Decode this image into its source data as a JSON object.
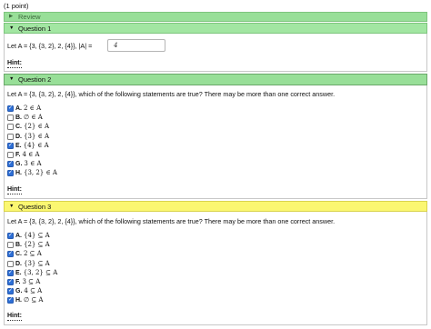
{
  "points": "(1 point)",
  "review": {
    "label": "Review",
    "icon": "triangle-right-icon"
  },
  "q1": {
    "header": "Question 1",
    "prompt": "Let A = {3, {3, 2}, 2, {4}}, |A| =",
    "answer": "4",
    "hint": "Hint:"
  },
  "q2": {
    "header": "Question 2",
    "prompt": "Let A = {3, {3, 2}, 2, {4}}, which of the following statements are true? There may be more than one correct answer.",
    "options": [
      {
        "letter": "A.",
        "expr": "2 ∈ A",
        "checked": true
      },
      {
        "letter": "B.",
        "expr": "∅ ∈ A",
        "checked": false
      },
      {
        "letter": "C.",
        "expr": "{2} ∈ A",
        "checked": false
      },
      {
        "letter": "D.",
        "expr": "{3} ∈ A",
        "checked": false
      },
      {
        "letter": "E.",
        "expr": "{4} ∈ A",
        "checked": true
      },
      {
        "letter": "F.",
        "expr": "4 ∈ A",
        "checked": false
      },
      {
        "letter": "G.",
        "expr": "3 ∈ A",
        "checked": true
      },
      {
        "letter": "H.",
        "expr": "{3, 2} ∈ A",
        "checked": true
      }
    ],
    "hint": "Hint:"
  },
  "q3": {
    "header": "Question 3",
    "prompt": "Let A = {3, {3, 2}, 2, {4}}, which of the following statements are true? There may be more than one correct answer.",
    "options": [
      {
        "letter": "A.",
        "expr": "{4} ⊆ A",
        "checked": true
      },
      {
        "letter": "B.",
        "expr": "{2} ⊆ A",
        "checked": false
      },
      {
        "letter": "C.",
        "expr": "2 ⊆ A",
        "checked": true
      },
      {
        "letter": "D.",
        "expr": "{3} ⊆ A",
        "checked": false
      },
      {
        "letter": "E.",
        "expr": "{3, 2} ⊆ A",
        "checked": true
      },
      {
        "letter": "F.",
        "expr": "3 ⊆ A",
        "checked": true
      },
      {
        "letter": "G.",
        "expr": "4 ⊆ A",
        "checked": true
      },
      {
        "letter": "H.",
        "expr": "∅ ⊆ A",
        "checked": true
      }
    ],
    "hint": "Hint:"
  },
  "colors": {
    "header_green": "#98df98",
    "header_yellow": "#fbf771",
    "checkbox_blue": "#2d6fd6"
  }
}
